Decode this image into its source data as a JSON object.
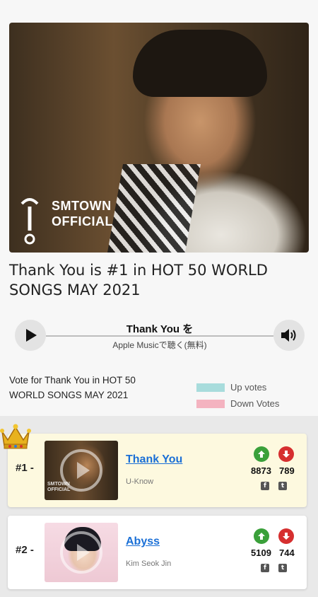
{
  "hero": {
    "logo_line1": "SMTOWN",
    "logo_line2": "OFFICIAL"
  },
  "headline": "Thank You is #1 in HOT 50 WORLD SONGS MAY 2021",
  "player": {
    "title": "Thank You を",
    "subtitle": "Apple Musicで聴く(無料)",
    "play_icon": "play-icon",
    "volume_icon": "speaker-icon"
  },
  "vote": {
    "prompt": "Vote for Thank You in HOT 50 WORLD SONGS MAY 2021",
    "legend": [
      {
        "label": "Up votes",
        "color": "#a8dcdc"
      },
      {
        "label": "Down Votes",
        "color": "#f4b3c0"
      }
    ]
  },
  "songs": [
    {
      "rank": "#1 -",
      "title": "Thank You",
      "artist": "U-Know",
      "up": "8873",
      "down": "789",
      "thumb_watermark1": "SMTOWN",
      "thumb_watermark2": "OFFICIAL"
    },
    {
      "rank": "#2 -",
      "title": "Abyss",
      "artist": "Kim Seok Jin",
      "up": "5109",
      "down": "744"
    }
  ],
  "colors": {
    "up": "#3aa03a",
    "down": "#d62f2f",
    "link": "#1a6fd6",
    "highlight": "#fdf9df"
  }
}
